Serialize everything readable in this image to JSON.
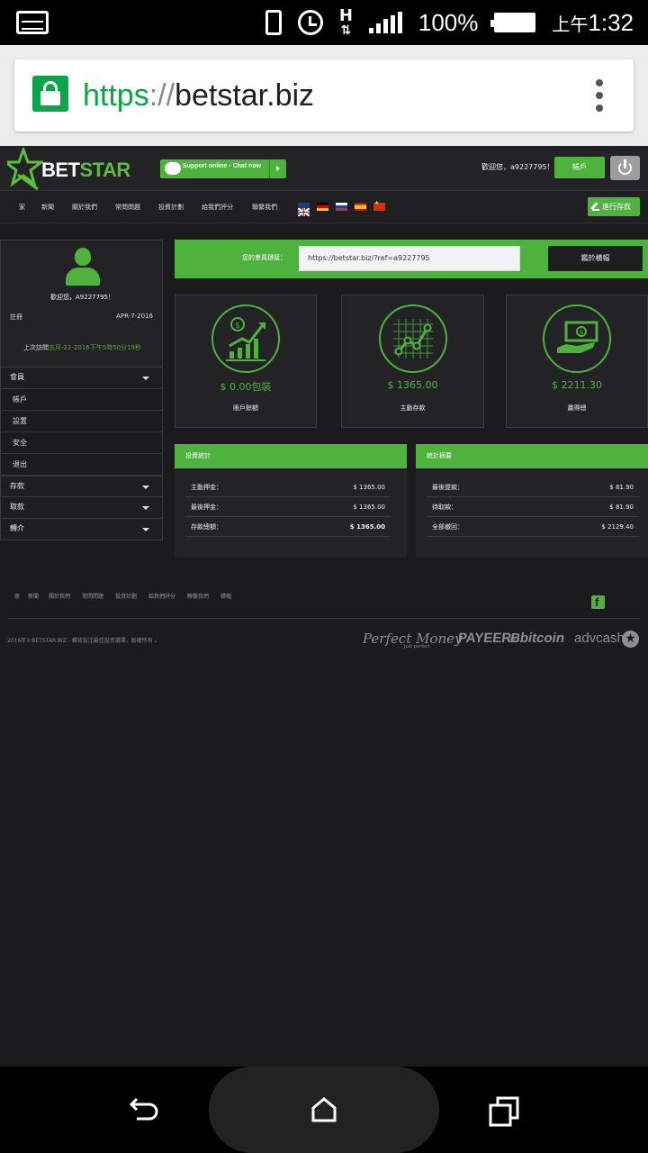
{
  "status_bar": {
    "battery_pct": "100%",
    "time_prefix": "上午",
    "time": "1:32",
    "network_type": "H"
  },
  "browser": {
    "url_scheme": "https",
    "url_sep": "://",
    "url_host": "betstar.biz"
  },
  "site_header": {
    "logo_bet": "BET",
    "logo_star": "STAR",
    "support_label": "Support online - Chat now",
    "welcome": "歡迎您，a9227795！",
    "account_label": "帳戶"
  },
  "nav": {
    "items": [
      "家",
      "新聞",
      "關於我們",
      "常問問題",
      "投資計劃",
      "給我們評分",
      "聯繫我們"
    ],
    "deposit_label": "進行存款",
    "flags": [
      "uk-flag",
      "germany-flag",
      "russia-flag",
      "spain-flag",
      "china-flag"
    ]
  },
  "sidebar": {
    "welcome": "歡迎您，A9227795！",
    "reg_label": "註冊",
    "reg_date": "APR-7-2016",
    "last_visit_label": "上次訪問",
    "last_visit_value": "五月-22-2016下午5時50分19秒",
    "sections": [
      {
        "label": "會員",
        "sub": [
          "帳戶",
          "設置",
          "安全",
          "退出"
        ]
      },
      {
        "label": "存款",
        "sub": []
      },
      {
        "label": "取款",
        "sub": []
      },
      {
        "label": "轉介",
        "sub": []
      }
    ]
  },
  "referral": {
    "label": "您的會員鏈接：",
    "link": "https://betstar.biz/?ref=a9227795",
    "button": "鑑於横幅"
  },
  "cards": [
    {
      "icon": "growth-chart-icon",
      "amount": "$ 0.00包裝",
      "label": "賬戶餘額"
    },
    {
      "icon": "trend-graph-icon",
      "amount": "$ 1365.00",
      "label": "主動存款"
    },
    {
      "icon": "money-hand-icon",
      "amount": "$ 2211.30",
      "label": "贏得總"
    }
  ],
  "panels": {
    "investment": {
      "title": "投資統計",
      "rows": [
        {
          "label": "主動押金：",
          "value": "$ 1365.00"
        },
        {
          "label": "最後押金：",
          "value": "$ 1365.00"
        },
        {
          "label": "存款總額：",
          "value": "$ 1365.00"
        }
      ]
    },
    "summary": {
      "title": "統計摘要",
      "rows": [
        {
          "label": "最後提款：",
          "value": "$ 81.90"
        },
        {
          "label": "待取款：",
          "value": "$ 81.90"
        },
        {
          "label": "全部撤回：",
          "value": "$ 2129.40"
        }
      ]
    }
  },
  "footer": {
    "links": [
      "家",
      "新聞",
      "關於我們",
      "常問問題",
      "投資計劃",
      "給我們評分",
      "聯繫我們",
      "橫幅"
    ],
    "copyright": "2016年©BETSTAR.BIZ - 轉背投注最佳投資選擇，版權所有 。",
    "payments": {
      "perfect_money": "Perfect Money",
      "perfect_money_tag": "Just perfect",
      "payeer": "PAYEER",
      "bitcoin": "bitcoin",
      "advcash": "advcash"
    }
  }
}
